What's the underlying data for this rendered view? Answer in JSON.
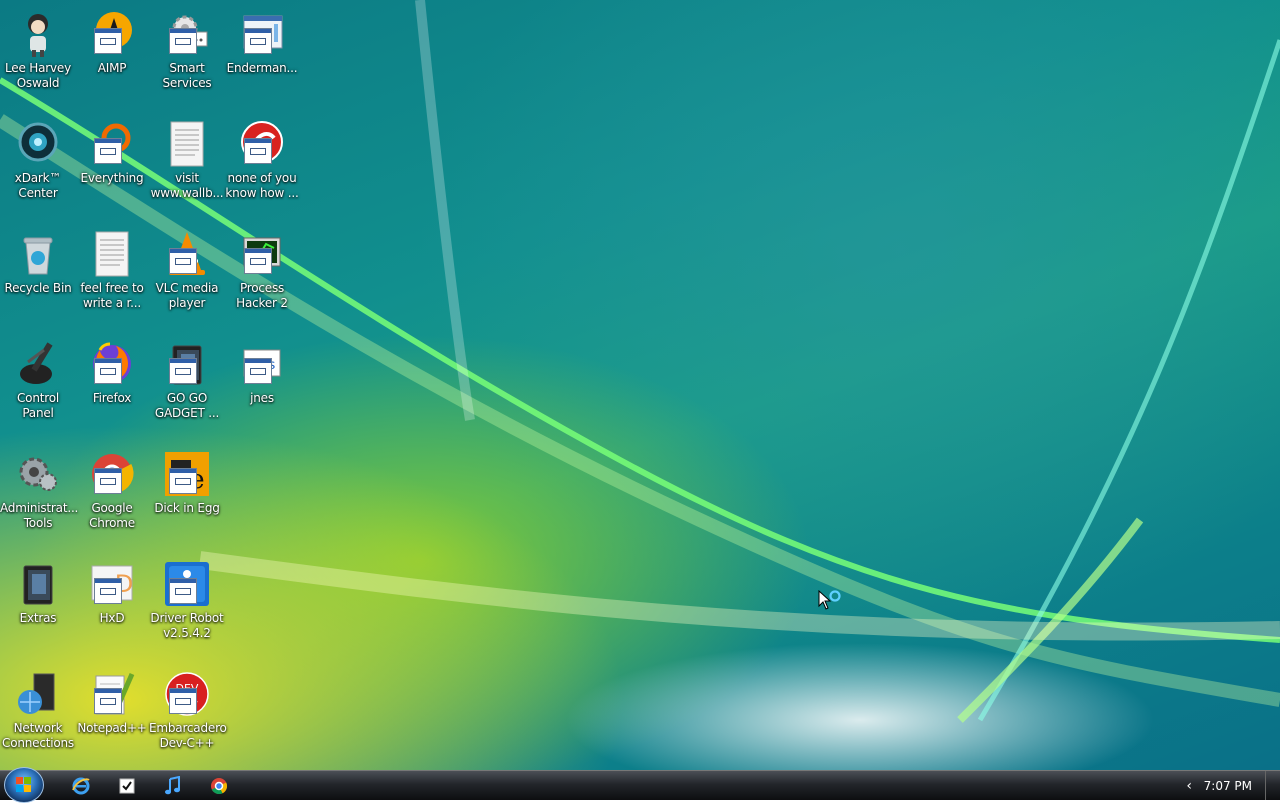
{
  "desktop_icons": [
    {
      "label": "Lee Harvey Oswald",
      "icon": "character-icon"
    },
    {
      "label": "AIMP",
      "icon": "aimp-icon"
    },
    {
      "label": "Smart Services",
      "icon": "gears-icon"
    },
    {
      "label": "Enderman...",
      "icon": "window-shortcut-icon"
    },
    {
      "label": "xDark™ Center",
      "icon": "xdark-icon"
    },
    {
      "label": "Everything",
      "icon": "everything-search-icon"
    },
    {
      "label": "visit www.wallb...",
      "icon": "text-document-icon"
    },
    {
      "label": "none of you know how ...",
      "icon": "red-circle-icon"
    },
    {
      "label": "Recycle Bin",
      "icon": "recycle-bin-icon"
    },
    {
      "label": "feel free to write a r...",
      "icon": "text-document-icon"
    },
    {
      "label": "VLC media player",
      "icon": "vlc-cone-icon"
    },
    {
      "label": "Process Hacker 2",
      "icon": "process-hacker-icon"
    },
    {
      "label": "Control Panel",
      "icon": "control-panel-icon"
    },
    {
      "label": "Firefox",
      "icon": "firefox-icon"
    },
    {
      "label": "GO GO GADGET ...",
      "icon": "folder-icon"
    },
    {
      "label": "jnes",
      "icon": "jnes-icon"
    },
    {
      "label": "Administrat... Tools",
      "icon": "admin-tools-icon"
    },
    {
      "label": "Google Chrome",
      "icon": "chrome-icon"
    },
    {
      "label": "Dick in Egg",
      "icon": "egg-icon"
    },
    {
      "label": "Extras",
      "icon": "folder-icon"
    },
    {
      "label": "HxD",
      "icon": "hxd-icon"
    },
    {
      "label": "Driver Robot v2.5.4.2",
      "icon": "driver-robot-icon"
    },
    {
      "label": "Network Connections",
      "icon": "network-icon"
    },
    {
      "label": "Notepad++",
      "icon": "notepadpp-icon"
    },
    {
      "label": "Embarcadero Dev-C++",
      "icon": "devcpp-icon"
    }
  ],
  "taskbar": {
    "start": "start-orb-icon",
    "pinned": [
      "internet-explorer-icon",
      "tasks-checkbox-icon",
      "music-note-icon",
      "chrome-icon"
    ],
    "tray_arrow": "‹",
    "clock": "7:07 PM"
  },
  "colors": {
    "taskbar": "#1c1f23",
    "wallpaper_teal": "#118f8e",
    "wallpaper_yellow": "#ece228"
  }
}
